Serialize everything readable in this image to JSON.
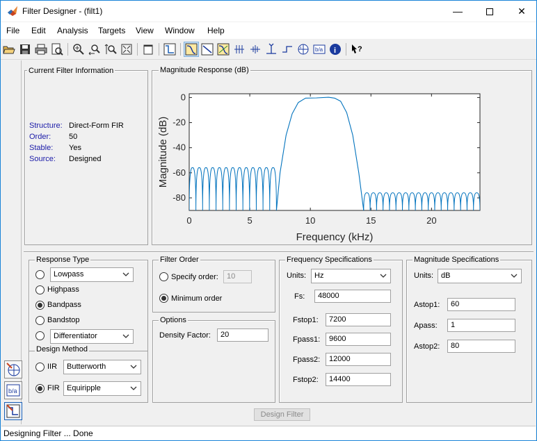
{
  "window": {
    "title": "Filter Designer -  (filt1)"
  },
  "menu": [
    "File",
    "Edit",
    "Analysis",
    "Targets",
    "View",
    "Window",
    "Help"
  ],
  "toolbar": [
    "open-icon",
    "save-icon",
    "print-icon",
    "print-preview-icon",
    "zoom-in-icon",
    "zoom-x-icon",
    "zoom-y-icon",
    "full-view-icon",
    "new-figure-icon",
    "filter-specs-icon",
    "magnitude-response-icon",
    "phase-response-icon",
    "magnitude-phase-icon",
    "group-delay-icon",
    "phase-delay-icon",
    "impulse-response-icon",
    "step-response-icon",
    "pole-zero-icon",
    "filter-coefficients-icon",
    "filter-info-icon",
    "whats-this-icon"
  ],
  "info": {
    "panel_title": "Current Filter Information",
    "structure_label": "Structure:",
    "structure_value": "Direct-Form FIR",
    "order_label": "Order:",
    "order_value": "50",
    "stable_label": "Stable:",
    "stable_value": "Yes",
    "source_label": "Source:",
    "source_value": "Designed"
  },
  "plot": {
    "panel_title": "Magnitude Response (dB)"
  },
  "chart_data": {
    "type": "line",
    "xlabel": "Frequency (kHz)",
    "ylabel": "Magnitude (dB)",
    "xlim": [
      0,
      24
    ],
    "ylim": [
      -90,
      3
    ],
    "xticks": [
      "0",
      "5",
      "10",
      "15",
      "20"
    ],
    "yticks": [
      "0",
      "-20",
      "-40",
      "-60",
      "-80"
    ],
    "xtick_values": [
      0,
      5,
      10,
      15,
      20
    ],
    "ytick_values": [
      0,
      -20,
      -40,
      -60,
      -80
    ],
    "grid": false,
    "series": [
      {
        "color": "#0072bd",
        "x": [
          7.2,
          7.5,
          8.0,
          8.5,
          9.0,
          9.6,
          10.5,
          11.5,
          12.0,
          12.5,
          13.0,
          13.5,
          14.0,
          14.4
        ],
        "y": [
          -90,
          -60,
          -30,
          -13,
          -4,
          -0.5,
          -0.3,
          0.2,
          -0.5,
          -3,
          -12,
          -30,
          -60,
          -90
        ]
      }
    ],
    "stopband1": {
      "x_end": 7.2,
      "lobe_top": -56,
      "lobes": 13
    },
    "stopband2": {
      "x_start": 14.4,
      "lobe_top": -76,
      "lobes": 18
    }
  },
  "response_type": {
    "title": "Response Type",
    "lowpass": "Lowpass",
    "highpass": "Highpass",
    "bandpass": "Bandpass",
    "bandstop": "Bandstop",
    "differentiator": "Differentiator",
    "selected": "Bandpass"
  },
  "design_method": {
    "title": "Design Method",
    "iir_label": "IIR",
    "iir_value": "Butterworth",
    "fir_label": "FIR",
    "fir_value": "Equiripple",
    "selected": "FIR"
  },
  "filter_order": {
    "title": "Filter Order",
    "specify_label": "Specify order:",
    "specify_value": "10",
    "minimum_label": "Minimum order",
    "selected": "Minimum order"
  },
  "options": {
    "title": "Options",
    "density_label": "Density Factor:",
    "density_value": "20"
  },
  "freq_specs": {
    "title": "Frequency Specifications",
    "units_label": "Units:",
    "units_value": "Hz",
    "fs_label": "Fs:",
    "fs_value": "48000",
    "fstop1_label": "Fstop1:",
    "fstop1_value": "7200",
    "fpass1_label": "Fpass1:",
    "fpass1_value": "9600",
    "fpass2_label": "Fpass2:",
    "fpass2_value": "12000",
    "fstop2_label": "Fstop2:",
    "fstop2_value": "14400"
  },
  "mag_specs": {
    "title": "Magnitude Specifications",
    "units_label": "Units:",
    "units_value": "dB",
    "astop1_label": "Astop1:",
    "astop1_value": "60",
    "apass_label": "Apass:",
    "apass_value": "1",
    "astop2_label": "Astop2:",
    "astop2_value": "80"
  },
  "design_button": "Design Filter",
  "status": "Designing Filter ... Done",
  "colors": {
    "accent": "#1883d7",
    "plot_line": "#0072bd",
    "info_label": "#1a1aa8"
  }
}
